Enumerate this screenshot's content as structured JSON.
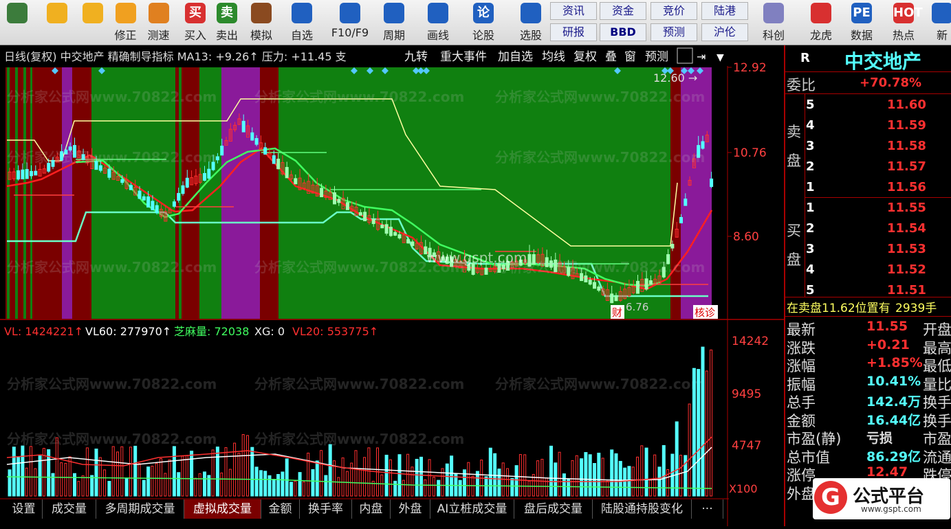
{
  "toolbar": {
    "items": [
      {
        "name": "layout-icon",
        "label": ""
      },
      {
        "name": "back-icon",
        "label": ""
      },
      {
        "name": "arrow-up-icon",
        "label": ""
      },
      {
        "name": "fix-icon",
        "label": "修正"
      },
      {
        "name": "timer-icon",
        "label": "测速"
      },
      {
        "name": "buy-icon",
        "label": "买入",
        "glyph": "买"
      },
      {
        "name": "sell-icon",
        "label": "卖出",
        "glyph": "卖"
      },
      {
        "name": "gavel-icon",
        "label": "模拟"
      },
      {
        "name": "star-icon",
        "label": "自选"
      },
      {
        "name": "f10-icon",
        "label": "F10/F9"
      },
      {
        "name": "period-icon",
        "label": "周期"
      },
      {
        "name": "pen-icon",
        "label": "画线"
      },
      {
        "name": "discuss-icon",
        "label": "论股",
        "glyph": "论"
      },
      {
        "name": "select-icon",
        "label": "选股"
      },
      {
        "name": "chart-trend-icon",
        "label": "科创"
      },
      {
        "name": "dragon-icon",
        "label": "龙虎"
      },
      {
        "name": "pe-icon",
        "label": "数据",
        "glyph": "PE"
      },
      {
        "name": "hot-icon",
        "label": "热点",
        "glyph": "HOT"
      },
      {
        "name": "new-icon",
        "label": "新"
      }
    ],
    "minis": [
      "资讯",
      "资金",
      "竞价",
      "陆港",
      "研报",
      "BBD",
      "预测",
      "沪伦"
    ]
  },
  "chart": {
    "header_left": "日线(复权) 中交地产 精确制导指标 MA13: +9.26↑ 压力: +11.45 支",
    "header_tabs": [
      "九转",
      "重大事件",
      "加自选",
      "均线",
      "复权",
      "叠",
      "窗",
      "预测"
    ],
    "price_axis": [
      "12.92",
      "10.76",
      "8.60"
    ],
    "max_label": "12.60",
    "min_label": "6.76",
    "cai_label": "财",
    "jiaozhen_label": "核诊",
    "vol_header": {
      "vl": "VL: 1424221↑",
      "vl60": "VL60: 277970↑",
      "zhima": "芝麻量: 72038",
      "xg": "XG: 0",
      "vl20": "VL20: 553775↑"
    },
    "vol_axis": [
      "14242",
      "9495",
      "4747"
    ],
    "vol_unit": "X100",
    "watermark": "分析家公式网www.70822.com",
    "watermark2": "www.gspt.com"
  },
  "bottom_tabs": [
    "设置",
    "成交量",
    "多周期成交量",
    "虚拟成交量",
    "金额",
    "换手率",
    "内盘",
    "外盘",
    "AI立桩成交量",
    "盘后成交量",
    "陆股通持股变化",
    "···"
  ],
  "quote": {
    "r": "R",
    "name": "中交地产",
    "weibi_label": "委比",
    "weibi": "+70.78%",
    "sell_label": "卖盘",
    "buy_label": "买盘",
    "sell": [
      [
        "5",
        "11.60"
      ],
      [
        "4",
        "11.59"
      ],
      [
        "3",
        "11.58"
      ],
      [
        "2",
        "11.57"
      ],
      [
        "1",
        "11.56"
      ]
    ],
    "buy": [
      [
        "1",
        "11.55"
      ],
      [
        "2",
        "11.54"
      ],
      [
        "3",
        "11.53"
      ],
      [
        "4",
        "11.52"
      ],
      [
        "5",
        "11.51"
      ]
    ],
    "zaimai": "在卖盘11.62位置有",
    "zaimai_qty": "2939手",
    "stats": [
      [
        "最新",
        "11.55",
        "开盘"
      ],
      [
        "涨跌",
        "+0.21",
        "最高"
      ],
      [
        "涨幅",
        "+1.85%",
        "最低"
      ],
      [
        "振幅",
        "10.41%",
        "量比"
      ],
      [
        "总手",
        "142.4万",
        "换手"
      ],
      [
        "金额",
        "16.44亿",
        "换手"
      ],
      [
        "市盈(静)",
        "亏损",
        "市盈"
      ],
      [
        "总市值",
        "86.29亿",
        "流通"
      ],
      [
        "涨停",
        "12.47",
        "跌停"
      ],
      [
        "外盘",
        "",
        ""
      ]
    ],
    "brand": "公式平台",
    "brand_url": "www.gspt.com"
  },
  "colors": {
    "red": "#ff3030",
    "cyan": "#54ffff",
    "green": "#108010",
    "purple": "#8a1a9a",
    "maroon": "#7a0000",
    "yellow": "#ffff60"
  }
}
